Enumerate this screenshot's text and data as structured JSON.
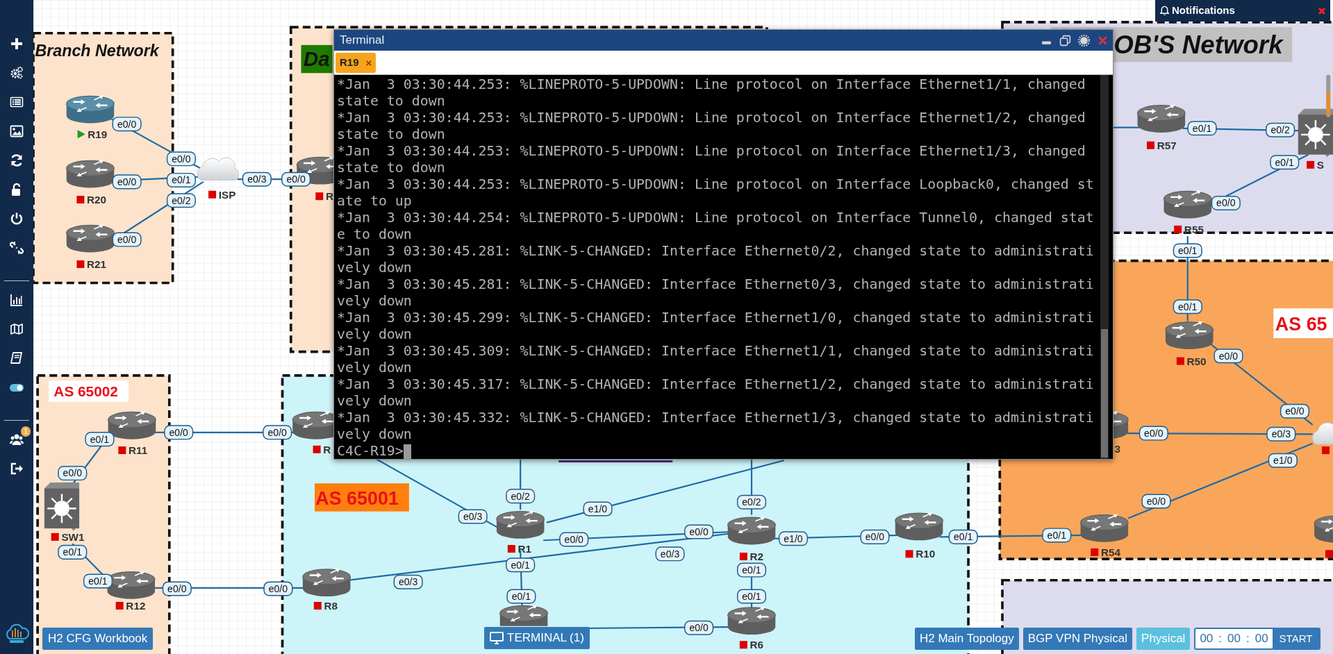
{
  "sidebar": {
    "badge": "1"
  },
  "areas": [
    {
      "color": "#fde3cb",
      "label": "Branch Network"
    },
    {
      "color": "#fde3cb",
      "label": "Da"
    },
    {
      "color": "#dcdcee",
      "label": "OB'S Network"
    },
    {
      "color": "#fde3cb",
      "label": "AS 65002"
    },
    {
      "color": "#cdf4f8",
      "label": "AS 65001"
    },
    {
      "color": "#f9a65a",
      "label": "AS 65"
    },
    {
      "color": "#dcdcee"
    }
  ],
  "nodes": [
    {
      "kind": "router",
      "label": "R19",
      "running": true
    },
    {
      "kind": "router",
      "label": "R20",
      "running": false
    },
    {
      "kind": "router",
      "label": "R21",
      "running": false
    },
    {
      "kind": "cloud",
      "label": "ISP",
      "running": false
    },
    {
      "kind": "router",
      "label": "R",
      "running": false
    },
    {
      "kind": "router",
      "label": "R11",
      "running": false
    },
    {
      "kind": "switch",
      "label": "SW1",
      "running": false
    },
    {
      "kind": "router",
      "label": "R12",
      "running": false
    },
    {
      "kind": "router",
      "label": "R",
      "running": false
    },
    {
      "kind": "router",
      "label": "R1",
      "running": false
    },
    {
      "kind": "router",
      "label": "R2",
      "running": false
    },
    {
      "kind": "router",
      "label": "R10",
      "running": false
    },
    {
      "kind": "router",
      "label": "R8",
      "running": false
    },
    {
      "kind": "router"
    },
    {
      "kind": "router",
      "label": "R6",
      "running": false
    },
    {
      "kind": "router",
      "label": "R57",
      "running": false
    },
    {
      "kind": "switch",
      "label": "S",
      "running": false
    },
    {
      "kind": "router",
      "label": "R55",
      "running": false
    },
    {
      "kind": "router",
      "label": "R50",
      "running": false
    },
    {
      "kind": "router",
      "label": "3"
    },
    {
      "kind": "router",
      "label": "R54",
      "running": false
    },
    {
      "kind": "cloud",
      "running": false
    },
    {
      "kind": "router",
      "running": false
    }
  ],
  "links": [
    {
      "kind": "cable",
      "ports": [
        "e0/0",
        "e0/0"
      ]
    },
    {
      "kind": "cable",
      "ports": [
        "e0/0",
        "e0/1"
      ]
    },
    {
      "kind": "cable",
      "ports": [
        "e0/0",
        "e0/2"
      ]
    },
    {
      "kind": "cable",
      "ports": [
        "e0/3",
        "e0/0"
      ]
    },
    {
      "kind": "cable",
      "ports": [
        "e0/0",
        "e0/0"
      ]
    },
    {
      "kind": "cable",
      "ports": [
        "e0/1",
        "e0/0"
      ]
    },
    {
      "kind": "cable",
      "ports": [
        "e0/1",
        "e0/1"
      ]
    },
    {
      "kind": "cable",
      "ports": [
        "e0/0",
        "e0/0"
      ]
    },
    {
      "kind": "cable",
      "ports": [
        "e0/3"
      ]
    },
    {
      "kind": "cable",
      "ports": [
        "e0/2"
      ]
    },
    {
      "kind": "cable",
      "ports": [
        "e1/0"
      ]
    },
    {
      "kind": "cable",
      "ports": [
        "e0/0",
        "e0/0"
      ]
    },
    {
      "kind": "cable",
      "ports": [
        "e0/3",
        "e0/3"
      ]
    },
    {
      "kind": "cable",
      "ports": [
        "e0/1",
        "e0/1"
      ]
    },
    {
      "kind": "cable",
      "ports": [
        "e0/2"
      ]
    },
    {
      "kind": "cable",
      "ports": [
        "e1/0",
        "e0/0"
      ]
    },
    {
      "kind": "cable",
      "ports": [
        "e0/1",
        "e0/1"
      ]
    },
    {
      "kind": "cable",
      "ports": [
        "e0/1",
        "e0/1"
      ]
    },
    {
      "kind": "cable",
      "ports": [
        "e0/0"
      ]
    },
    {
      "kind": "cable"
    },
    {
      "kind": "cable",
      "ports": [
        "e0/1",
        "e0/2"
      ]
    },
    {
      "kind": "cable",
      "ports": [
        "e0/0",
        "e0/1"
      ]
    },
    {
      "kind": "cable",
      "ports": [
        "e0/1",
        "e0/1"
      ]
    },
    {
      "kind": "cable",
      "ports": [
        "e0/0",
        "e0/0"
      ]
    },
    {
      "kind": "cable",
      "ports": [
        "e0/0",
        "e0/3"
      ]
    },
    {
      "kind": "cable",
      "ports": [
        "e0/0",
        "e1/0"
      ]
    },
    {
      "kind": "bar"
    }
  ],
  "terminal": {
    "title": "Terminal",
    "tabs": [
      {
        "label": "R19",
        "close": "×",
        "selected": true
      }
    ],
    "lines": [
      "*Jan  3 03:30:44.253: %LINEPROTO-5-UPDOWN: Line protocol on Interface Ethernet1/1, changed",
      "state to down",
      "*Jan  3 03:30:44.253: %LINEPROTO-5-UPDOWN: Line protocol on Interface Ethernet1/2, changed",
      "state to down",
      "*Jan  3 03:30:44.253: %LINEPROTO-5-UPDOWN: Line protocol on Interface Ethernet1/3, changed",
      "state to down",
      "*Jan  3 03:30:44.253: %LINEPROTO-5-UPDOWN: Line protocol on Interface Loopback0, changed st",
      "ate to up",
      "*Jan  3 03:30:44.254: %LINEPROTO-5-UPDOWN: Line protocol on Interface Tunnel0, changed stat",
      "e to down",
      "*Jan  3 03:30:45.281: %LINK-5-CHANGED: Interface Ethernet0/2, changed state to administrati",
      "vely down",
      "*Jan  3 03:30:45.281: %LINK-5-CHANGED: Interface Ethernet0/3, changed state to administrati",
      "vely down",
      "*Jan  3 03:30:45.299: %LINK-5-CHANGED: Interface Ethernet1/0, changed state to administrati",
      "vely down",
      "*Jan  3 03:30:45.309: %LINK-5-CHANGED: Interface Ethernet1/1, changed state to administrati",
      "vely down",
      "*Jan  3 03:30:45.317: %LINK-5-CHANGED: Interface Ethernet1/2, changed state to administrati",
      "vely down",
      "*Jan  3 03:30:45.332: %LINK-5-CHANGED: Interface Ethernet1/3, changed state to administrati",
      "vely down"
    ],
    "prompt": "C4C-R19>"
  },
  "notifications": {
    "title": "Notifications"
  },
  "bottom": {
    "workbook": "H2 CFG Workbook",
    "terminal": "TERMINAL (1)",
    "topologies": [
      {
        "label": "H2 Main Topology",
        "selected": false
      },
      {
        "label": "BGP VPN Physical",
        "selected": false
      },
      {
        "label": "Physical",
        "selected": true
      }
    ],
    "timer": {
      "hours": "00",
      "minutes": "00",
      "seconds": "00",
      "separator": ":"
    },
    "start": "START"
  }
}
